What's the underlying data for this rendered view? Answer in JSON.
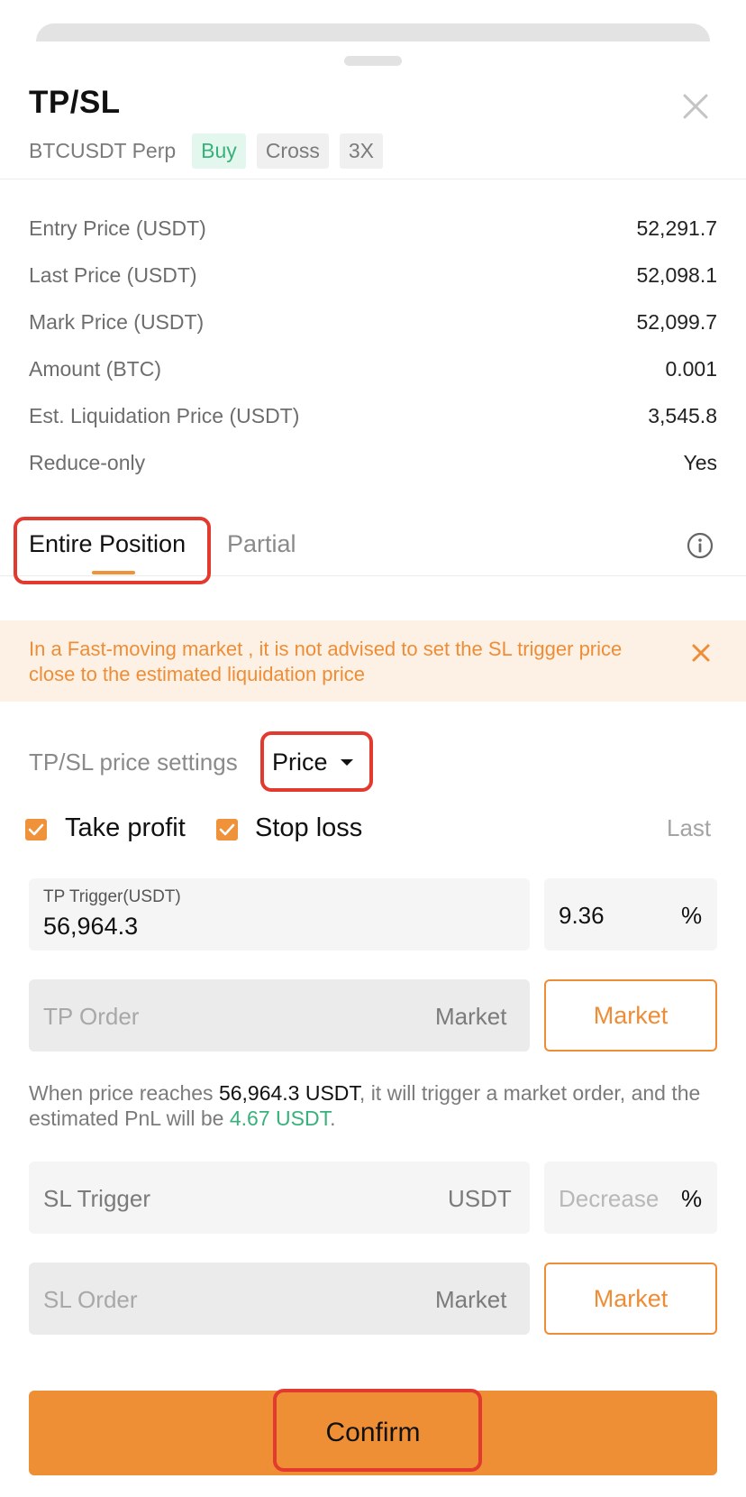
{
  "header": {
    "title": "TP/SL",
    "symbol": "BTCUSDT Perp",
    "side": "Buy",
    "margin_mode": "Cross",
    "leverage": "3X"
  },
  "info_rows": [
    {
      "label": "Entry Price (USDT)",
      "value": "52,291.7"
    },
    {
      "label": "Last Price (USDT)",
      "value": "52,098.1"
    },
    {
      "label": "Mark Price (USDT)",
      "value": "52,099.7"
    },
    {
      "label": "Amount (BTC)",
      "value": "0.001"
    },
    {
      "label": "Est. Liquidation Price (USDT)",
      "value": "3,545.8"
    },
    {
      "label": "Reduce-only",
      "value": "Yes"
    }
  ],
  "tabs": [
    {
      "label": "Entire Position",
      "active": true
    },
    {
      "label": "Partial",
      "active": false
    }
  ],
  "warning": {
    "text": "In a Fast-moving market , it is not advised to set the SL trigger price close to the estimated liquidation price"
  },
  "settings": {
    "label": "TP/SL price settings",
    "mode": "Price"
  },
  "checkboxes": {
    "take_profit": "Take profit",
    "stop_loss": "Stop loss",
    "price_type": "Last"
  },
  "tp": {
    "trigger_label": "TP Trigger(USDT)",
    "trigger_value": "56,964.3",
    "percent_value": "9.36",
    "percent_sign": "%",
    "order_placeholder": "TP Order",
    "order_unit": "Market",
    "order_button": "Market"
  },
  "hint": {
    "prefix": "When price reaches",
    "price": "56,964.3 USDT",
    "middle": ", it will trigger a market order, and the estimated PnL will be",
    "pnl": "4.67 USDT",
    "suffix": "."
  },
  "sl": {
    "trigger_placeholder": "SL Trigger",
    "trigger_unit": "USDT",
    "percent_placeholder": "Decrease",
    "percent_sign": "%",
    "order_placeholder": "SL Order",
    "order_unit": "Market",
    "order_button": "Market"
  },
  "confirm_label": "Confirm",
  "colors": {
    "accent": "#ef8f35",
    "buy_green": "#38b27a",
    "highlight_red": "#e33a2f"
  }
}
